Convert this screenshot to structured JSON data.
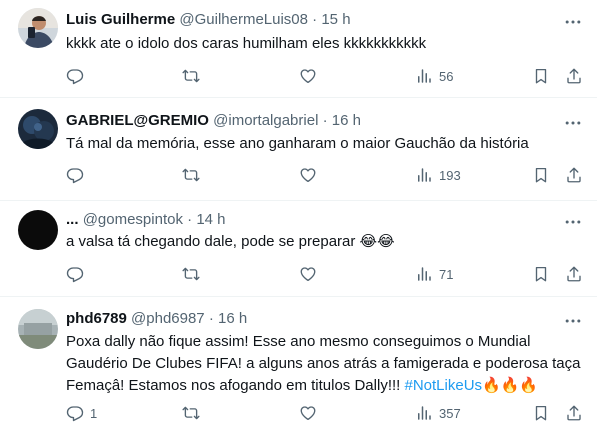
{
  "tweets": [
    {
      "name": "Luis Guilherme",
      "handle": "@GuilhermeLuis08",
      "separator": "·",
      "time": "15 h",
      "text": "kkkk ate o idolo dos caras humilham eles kkkkkkkkkkk",
      "replies": "",
      "reposts": "",
      "likes": "",
      "views": "56"
    },
    {
      "name": "GABRIEL@GREMIO",
      "handle": "@imortalgabriel",
      "separator": "·",
      "time": "16 h",
      "text": "Tá mal da memória, esse ano ganharam o maior Gauchão da história",
      "replies": "",
      "reposts": "",
      "likes": "",
      "views": "193"
    },
    {
      "name": "...",
      "handle": "@gomespintok",
      "separator": "·",
      "time": "14 h",
      "text": "a valsa tá chegando dale, pode se preparar",
      "emoji": "😂😂",
      "replies": "",
      "reposts": "",
      "likes": "",
      "views": "71"
    },
    {
      "name": "phd6789",
      "handle": "@phd6987",
      "separator": "·",
      "time": "16 h",
      "text_line1": "Poxa dally não fique assim! Esse ano mesmo conseguimos o Mundial",
      "text_line2": "Gaudério De Clubes FIFA! a alguns anos atrás a famigerada e poderosa taça",
      "text_line3": "Femaçâ! Estamos nos afogando em titulos Dally!!! ",
      "hashtag": "#NotLikeUs",
      "emoji": "🔥🔥🔥",
      "replies": "1",
      "reposts": "",
      "likes": "",
      "views": "357"
    }
  ],
  "icons": [
    "more-icon",
    "reply-icon",
    "repost-icon",
    "like-icon",
    "views-icon",
    "bookmark-icon",
    "share-icon"
  ],
  "colors": {
    "text": "#0f1419",
    "secondary": "#536471",
    "link": "#1d9bf0",
    "divider": "#eff3f4"
  }
}
